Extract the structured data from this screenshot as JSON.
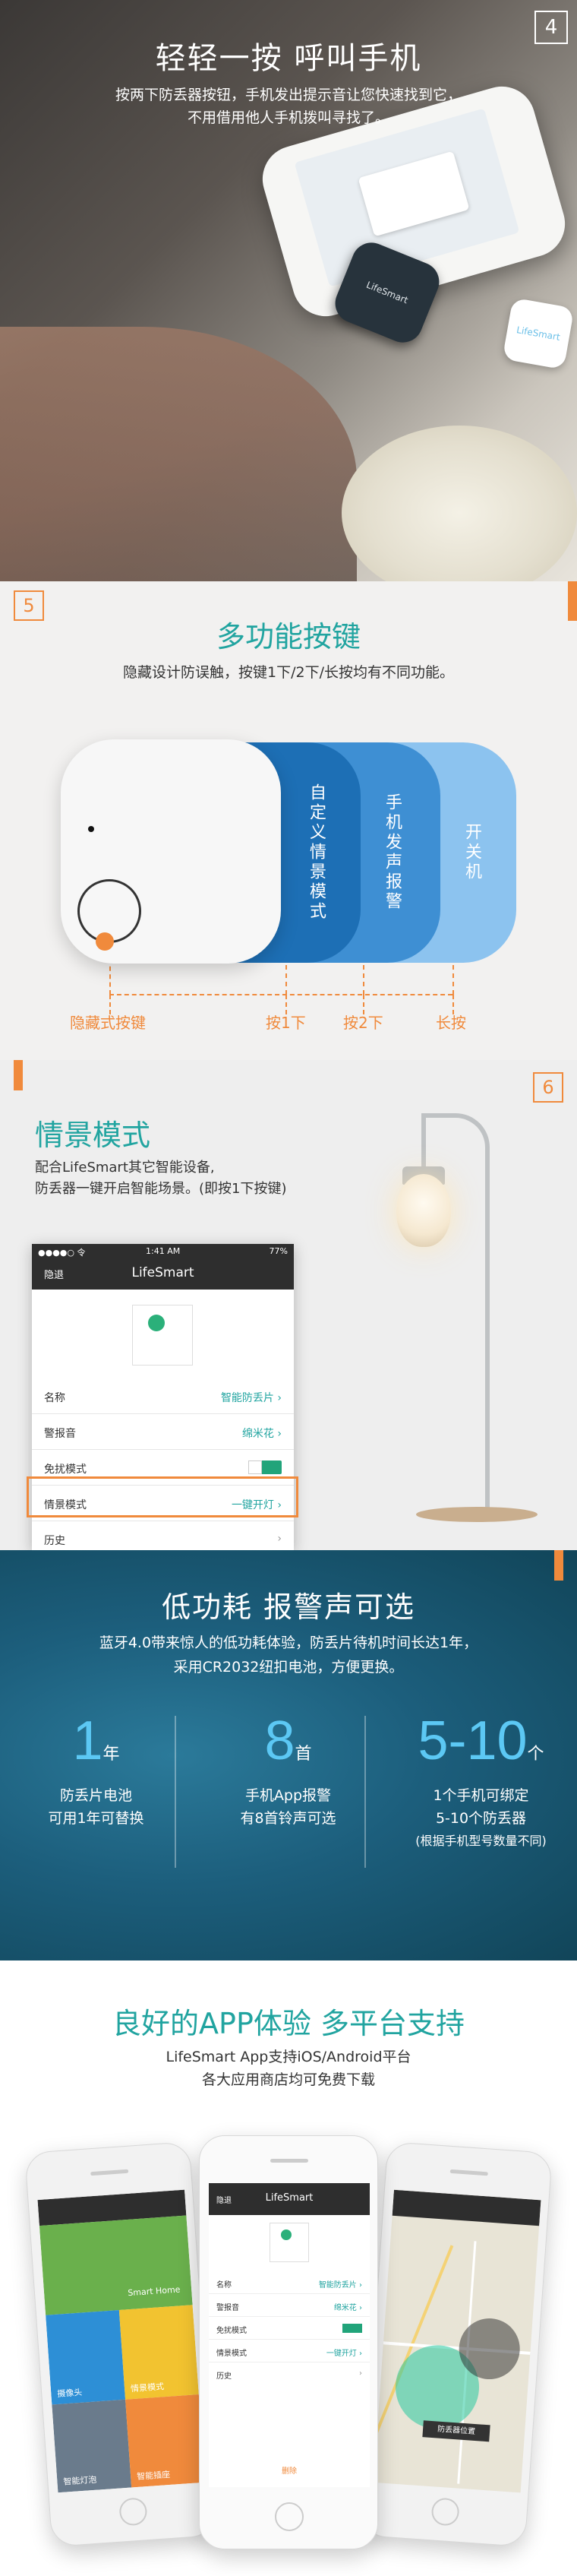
{
  "s1": {
    "num": "4",
    "title": "轻轻一按 呼叫手机",
    "sub_line1": "按两下防丢器按钮，手机发出提示音让您快速找到它，",
    "sub_line2": "不用借用他人手机拨叫寻找了。",
    "tag_dark_text": "LifeSmart",
    "tag_white_text": "LifeSmart"
  },
  "s2": {
    "num": "5",
    "title": "多功能按键",
    "sub": "隐藏设计防误触，按键1下/2下/长按均有不同功能。",
    "band1_text": "自定义情景模式",
    "band2_text": "手机发声报警",
    "band3_text": "开关机",
    "label_hidden": "隐藏式按键",
    "label_1": "按1下",
    "label_2": "按2下",
    "label_long": "长按"
  },
  "s3": {
    "num": "6",
    "title": "情景模式",
    "sub_line1": "配合LifeSmart其它智能设备,",
    "sub_line2": "防丢器一键开启智能场景。(即按1下按键)",
    "app": {
      "status_left": "●●●●○ 令",
      "status_time": "1:41 AM",
      "status_right": "77%",
      "back": "隐退",
      "nav_title": "LifeSmart",
      "rows": [
        {
          "k": "名称",
          "v": "智能防丢片 ›"
        },
        {
          "k": "警报音",
          "v": "绵米花 ›"
        },
        {
          "k": "免扰模式",
          "v": ""
        },
        {
          "k": "情景模式",
          "v": "一键开灯 ›"
        },
        {
          "k": "历史",
          "v": "›"
        }
      ]
    }
  },
  "s4": {
    "title": "低功耗 报警声可选",
    "sub_line1": "蓝牙4.0带来惊人的低功耗体验，防丢片待机时间长达1年，",
    "sub_line2": "采用CR2032纽扣电池，方便更换。",
    "stats": [
      {
        "big": "1",
        "unit": "年",
        "t1": "防丢片电池",
        "t2": "可用1年可替换",
        "t3": ""
      },
      {
        "big": "8",
        "unit": "首",
        "t1": "手机App报警",
        "t2": "有8首铃声可选",
        "t3": ""
      },
      {
        "big": "5-10",
        "unit": "个",
        "t1": "1个手机可绑定",
        "t2": "5-10个防丢器",
        "t3": "(根据手机型号数量不同)"
      }
    ]
  },
  "s5": {
    "title": "良好的APP体验 多平台支持",
    "sub_line1": "LifeSmart App支持iOS/Android平台",
    "sub_line2": "各大应用商店均可免费下载",
    "phone_center": {
      "nav_back": "隐退",
      "nav_title": "LifeSmart",
      "rows": [
        {
          "k": "名称",
          "v": "智能防丢片 ›"
        },
        {
          "k": "警报音",
          "v": "绵米花 ›"
        },
        {
          "k": "免扰模式",
          "v": ""
        },
        {
          "k": "情景模式",
          "v": "一键开灯 ›"
        },
        {
          "k": "历史",
          "v": "›"
        }
      ],
      "bottom_btn": "删除"
    },
    "phone_left_tiles": [
      "Smart Home",
      "情景模式",
      "摄像头",
      "智能灯泡",
      "智能灯",
      "智能插座"
    ],
    "phone_right_badge": "防丢器位置"
  }
}
